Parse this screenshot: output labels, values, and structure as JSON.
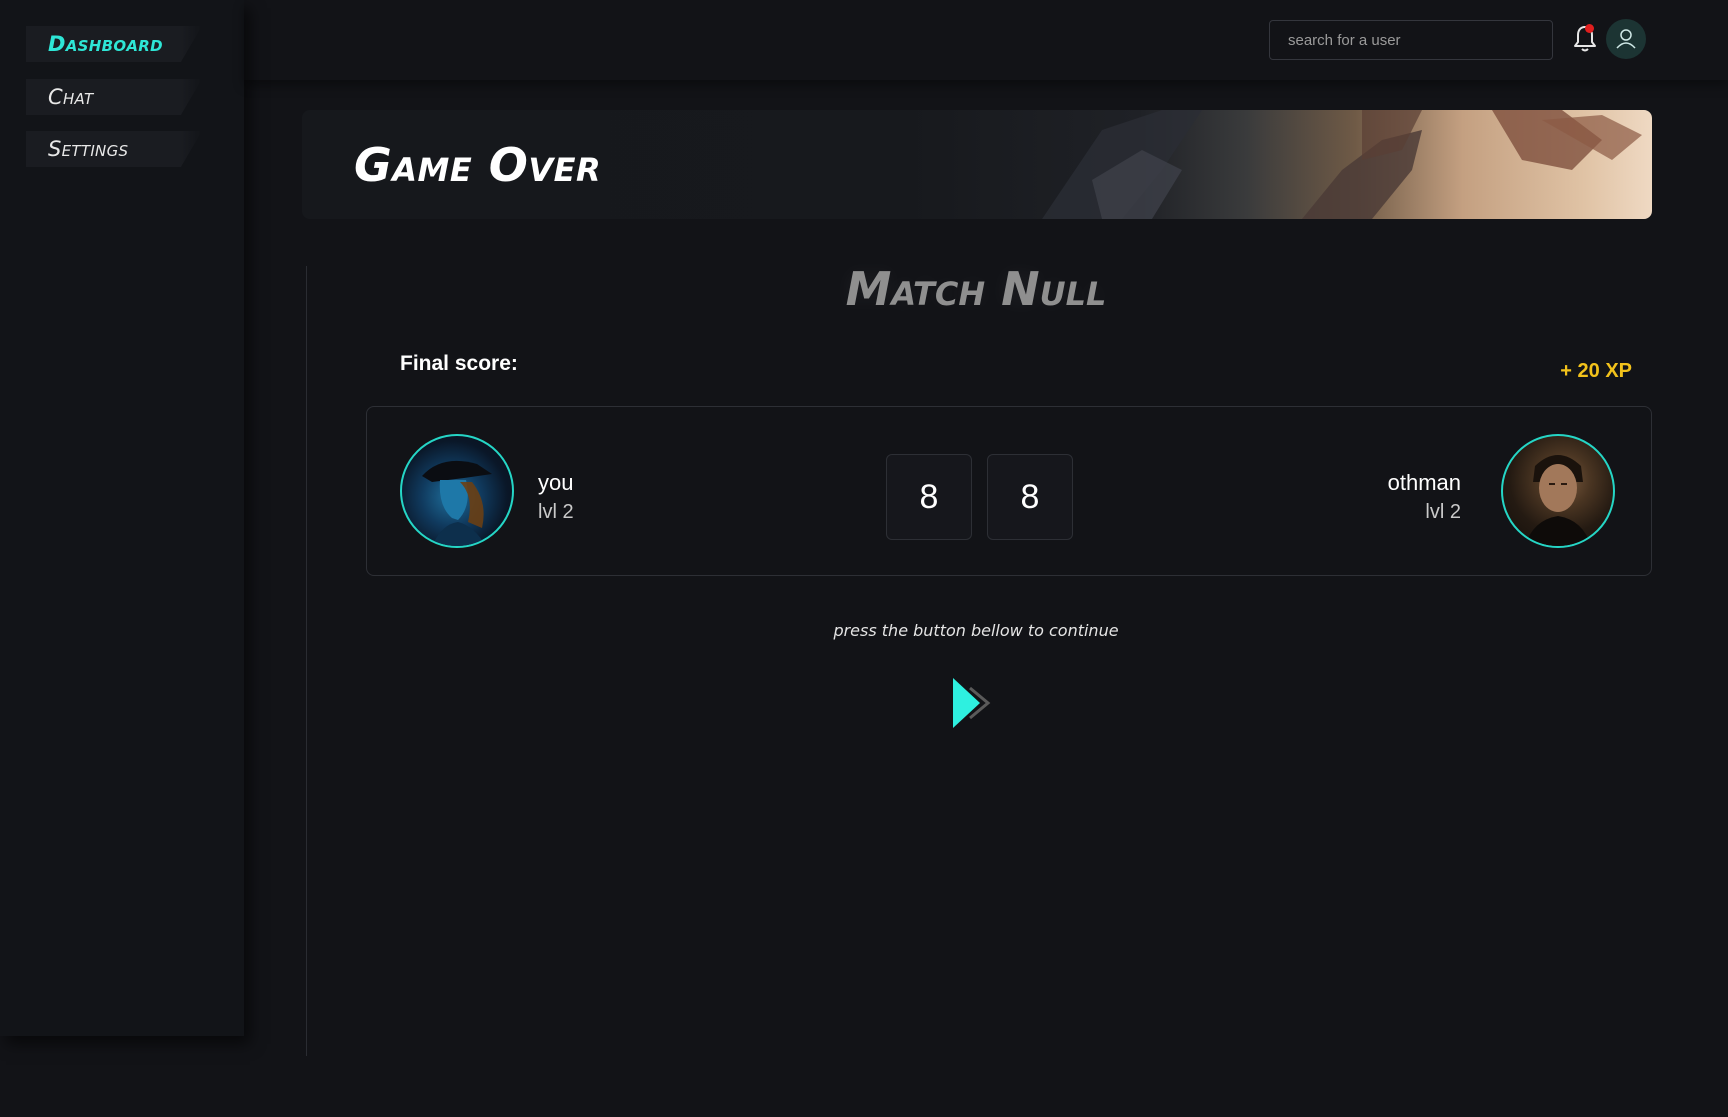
{
  "sidebar": {
    "items": [
      {
        "label": "Dashboard",
        "active": true
      },
      {
        "label": "Chat",
        "active": false
      },
      {
        "label": "Settings",
        "active": false
      }
    ]
  },
  "header": {
    "search_placeholder": "search for a user",
    "notification_icon": "bell-icon",
    "profile_icon": "user-icon"
  },
  "banner": {
    "title": "Game Over"
  },
  "result": {
    "title": "Match Null",
    "final_score_label": "Final score:",
    "xp_reward": "+ 20 XP",
    "players": [
      {
        "name": "you",
        "level": "lvl 2",
        "score": "8"
      },
      {
        "name": "othman",
        "level": "lvl 2",
        "score": "8"
      }
    ],
    "continue_text": "press the button bellow to continue"
  },
  "colors": {
    "accent": "#2ee6d6",
    "xp": "#f2c21b",
    "notification_dot": "#e01e1e",
    "background": "#121317"
  }
}
